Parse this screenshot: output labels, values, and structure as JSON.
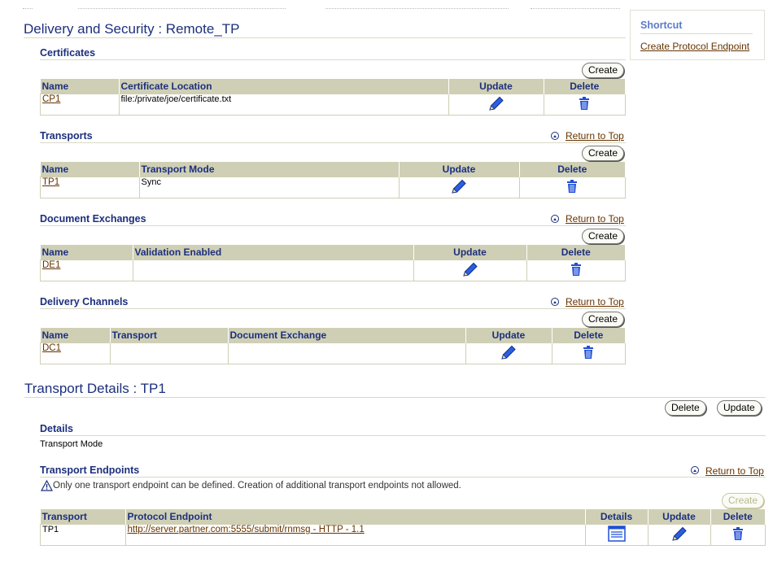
{
  "delivery": {
    "title": "Delivery and Security : Remote_TP",
    "return_to_top": "Return to Top",
    "certificates": {
      "heading": "Certificates",
      "create": "Create",
      "columns": [
        "Name",
        "Certificate Location",
        "Update",
        "Delete"
      ],
      "rows": [
        {
          "name": "CP1",
          "location": "file:/private/joe/certificate.txt"
        }
      ]
    },
    "transports": {
      "heading": "Transports",
      "create": "Create",
      "columns": [
        "Name",
        "Transport Mode",
        "Update",
        "Delete"
      ],
      "rows": [
        {
          "name": "TP1",
          "mode": "Sync"
        }
      ]
    },
    "document_exchanges": {
      "heading": "Document Exchanges",
      "create": "Create",
      "columns": [
        "Name",
        "Validation Enabled",
        "Update",
        "Delete"
      ],
      "rows": [
        {
          "name": "DE1",
          "validation": ""
        }
      ]
    },
    "delivery_channels": {
      "heading": "Delivery Channels",
      "create": "Create",
      "columns": [
        "Name",
        "Transport",
        "Document Exchange",
        "Update",
        "Delete"
      ],
      "rows": [
        {
          "name": "DC1",
          "transport": "",
          "doc_exchange": ""
        }
      ]
    }
  },
  "shortcut": {
    "heading": "Shortcut",
    "link": "Create Protocol Endpoint"
  },
  "transport_details": {
    "title": "Transport Details : TP1",
    "delete": "Delete",
    "update": "Update",
    "details_heading": "Details",
    "details_text": "Transport Mode",
    "endpoints_heading": "Transport Endpoints",
    "return_to_top": "Return to Top",
    "warning": "Only one transport endpoint can be defined. Creation of additional transport endpoints not allowed.",
    "create": "Create",
    "columns": [
      "Transport",
      "Protocol Endpoint",
      "Details",
      "Update",
      "Delete"
    ],
    "rows": [
      {
        "transport": "TP1",
        "endpoint": "http://server.partner.com:5555/submit/rnmsg - HTTP - 1.1"
      }
    ]
  },
  "colors": {
    "heading": "#1c2f7d",
    "link": "#663300",
    "table_header": "#cfcfb5",
    "icon_blue": "#1f4fd8"
  },
  "icons": [
    "pencil-icon",
    "trash-icon",
    "details-icon",
    "warning-icon",
    "return-to-top-icon"
  ]
}
